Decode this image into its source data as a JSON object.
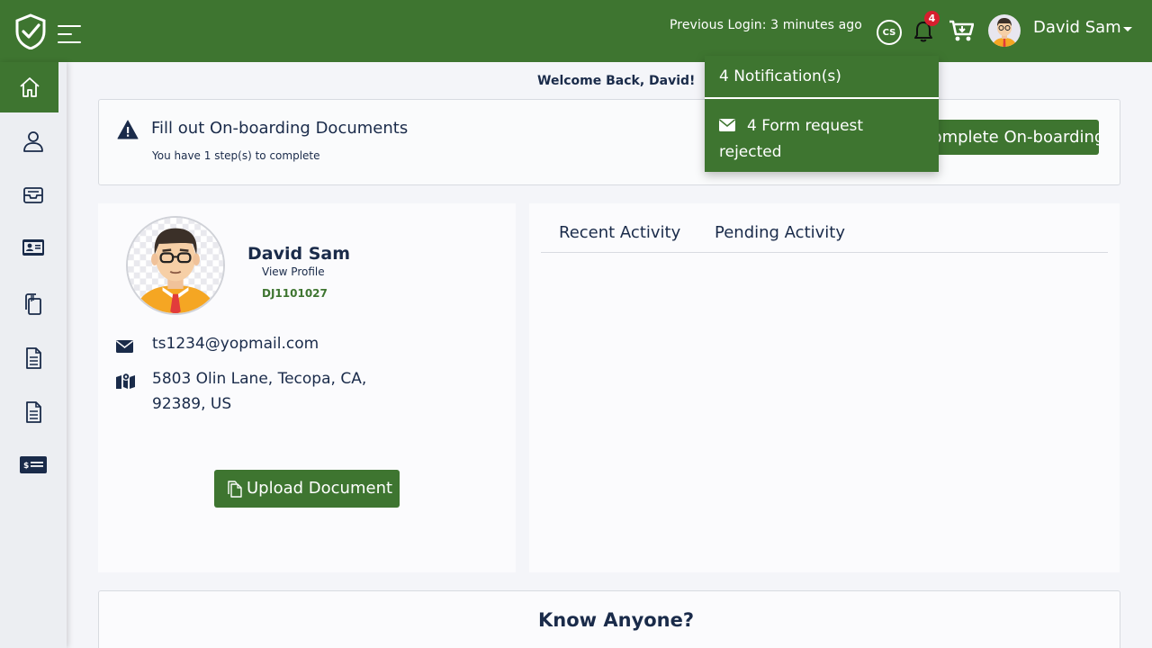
{
  "header": {
    "previous_login": "Previous Login: 3 minutes ago",
    "cs_label": "CS",
    "notification_count": "4",
    "user_name": "David Sam"
  },
  "sidebar": {
    "items": [
      {
        "icon": "home-icon",
        "active": true
      },
      {
        "icon": "user-icon",
        "active": false
      },
      {
        "icon": "inbox-icon",
        "active": false
      },
      {
        "icon": "id-card-icon",
        "active": false
      },
      {
        "icon": "documents-icon",
        "active": false
      },
      {
        "icon": "file-icon",
        "active": false
      },
      {
        "icon": "file-icon",
        "active": false
      },
      {
        "icon": "money-check-icon",
        "active": false
      }
    ]
  },
  "welcome": "Welcome Back, David!",
  "onboarding": {
    "title": "Fill out On-boarding Documents",
    "subtitle": "You have 1 step(s) to complete",
    "button": "Complete On-boarding"
  },
  "notifications": {
    "header": "4 Notification(s)",
    "items": [
      {
        "text": "4 Form request rejected",
        "icon": "envelope-icon"
      }
    ]
  },
  "profile": {
    "name": "David Sam",
    "view_profile": "View Profile",
    "id": "DJ1101027",
    "email": "ts1234@yopmail.com",
    "address": "5803 Olin Lane, Tecopa, CA, 92389, US",
    "upload_button": "Upload Document"
  },
  "activity": {
    "tabs": [
      "Recent Activity",
      "Pending Activity"
    ]
  },
  "know_anyone": {
    "title": "Know Anyone?"
  },
  "colors": {
    "brand_green": "#3e7530",
    "badge_red": "#d71f2e",
    "text_navy": "#1a2b4a"
  }
}
